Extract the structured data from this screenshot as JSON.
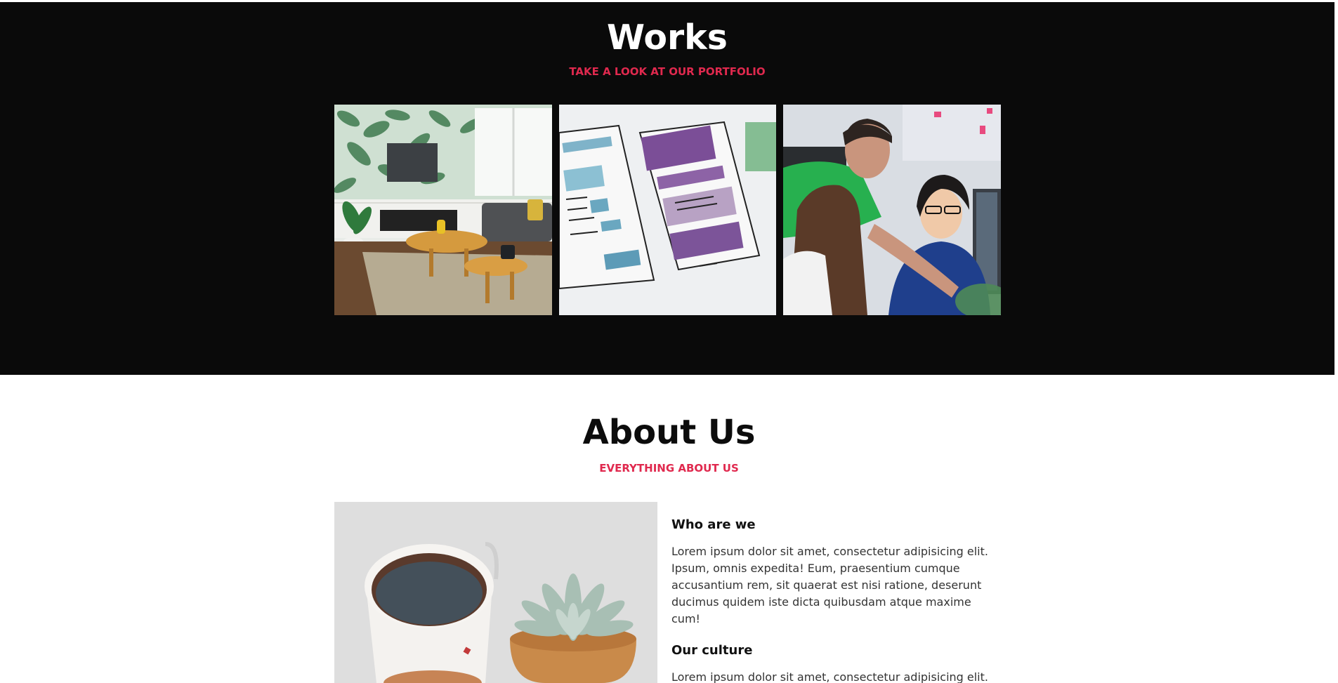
{
  "works": {
    "title": "Works",
    "subtitle": "TAKE A LOOK AT OUR PORTFOLIO",
    "items": [
      {
        "name": "living-room-photo"
      },
      {
        "name": "wireframe-sketch-photo"
      },
      {
        "name": "team-at-computer-photo"
      }
    ]
  },
  "about": {
    "title": "About Us",
    "subtitle": "EVERYTHING ABOUT US",
    "blocks": [
      {
        "heading": "Who are we",
        "text": "Lorem ipsum dolor sit amet, consectetur adipisicing elit. Ipsum, omnis expedita! Eum, praesentium cumque accusantium rem, sit quaerat est nisi ratione, deserunt ducimus quidem iste dicta quibusdam atque maxime cum!"
      },
      {
        "heading": "Our culture",
        "text": "Lorem ipsum dolor sit amet, consectetur adipisicing elit."
      }
    ]
  },
  "colors": {
    "accent": "#e0294e",
    "dark_bg": "#0a0a0a"
  }
}
